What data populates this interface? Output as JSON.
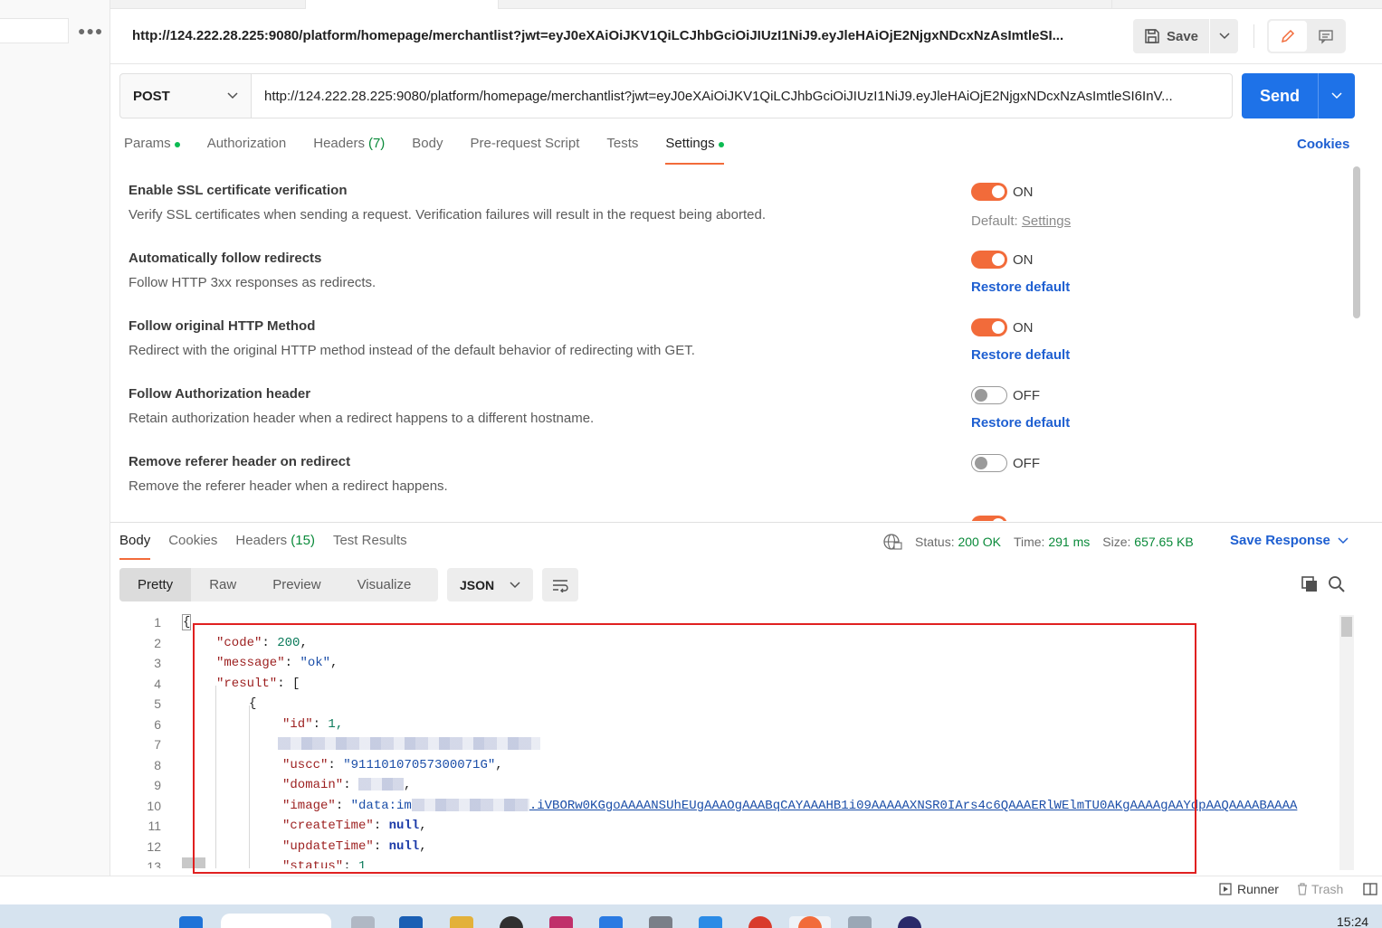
{
  "sidebar": {
    "more_icon": "more-icon"
  },
  "header": {
    "title": "http://124.222.28.225:9080/platform/homepage/merchantlist?jwt=eyJ0eXAiOiJKV1QiLCJhbGciOiJIUzI1NiJ9.eyJleHAiOjE2NjgxNDcxNzAsImtleSI...",
    "save_label": "Save"
  },
  "request": {
    "method": "POST",
    "url": "http://124.222.28.225:9080/platform/homepage/merchantlist?jwt=eyJ0eXAiOiJKV1QiLCJhbGciOiJIUzI1NiJ9.eyJleHAiOjE2NjgxNDcxNzAsImtleSI6InV...",
    "send_label": "Send"
  },
  "request_tabs": [
    {
      "label": "Params",
      "dot": true
    },
    {
      "label": "Authorization"
    },
    {
      "label": "Headers",
      "count": "(7)"
    },
    {
      "label": "Body"
    },
    {
      "label": "Pre-request Script"
    },
    {
      "label": "Tests"
    },
    {
      "label": "Settings",
      "dot": true,
      "active": true
    }
  ],
  "cookies_label": "Cookies",
  "settings": [
    {
      "title": "Enable SSL certificate verification",
      "desc": "Verify SSL certificates when sending a request. Verification failures will result in the request being aborted.",
      "state": "ON",
      "default_prefix": "Default:",
      "default_link": "Settings"
    },
    {
      "title": "Automatically follow redirects",
      "desc": "Follow HTTP 3xx responses as redirects.",
      "state": "ON",
      "restore": "Restore default"
    },
    {
      "title": "Follow original HTTP Method",
      "desc": "Redirect with the original HTTP method instead of the default behavior of redirecting with GET.",
      "state": "ON",
      "restore": "Restore default"
    },
    {
      "title": "Follow Authorization header",
      "desc": "Retain authorization header when a redirect happens to a different hostname.",
      "state": "OFF",
      "restore": "Restore default"
    },
    {
      "title": "Remove referer header on redirect",
      "desc": "Remove the referer header when a redirect happens.",
      "state": "OFF"
    }
  ],
  "response": {
    "tabs": [
      {
        "label": "Body",
        "active": true
      },
      {
        "label": "Cookies"
      },
      {
        "label": "Headers",
        "count": "(15)"
      },
      {
        "label": "Test Results"
      }
    ],
    "status_label": "Status:",
    "status_value": "200 OK",
    "time_label": "Time:",
    "time_value": "291 ms",
    "size_label": "Size:",
    "size_value": "657.65 KB",
    "save_response": "Save Response",
    "views": [
      "Pretty",
      "Raw",
      "Preview",
      "Visualize"
    ],
    "format": "JSON"
  },
  "code_lines": {
    "l1": "{",
    "l2_key": "\"code\"",
    "l2_val": "200",
    "l3_key": "\"message\"",
    "l3_val": "\"ok\"",
    "l4_key": "\"result\"",
    "l4_val": "[",
    "l5": "{",
    "l6_key": "\"id\"",
    "l6_val": "1,",
    "l8_key": "\"uscc\"",
    "l8_val": "\"91110107057300071G\"",
    "l9_key": "\"domain\"",
    "l10_key": "\"image\"",
    "l10_val_start": "\"data:im",
    "l10_val_end": ".iVBORw0KGgoAAAANSUhEUgAAAOgAAABqCAYAAAHB1i09AAAAAXNSR0IArs4c6QAAAERlWElmTU0AKgAAAAgAAYdpAAQAAAABAAAA",
    "l11_key": "\"createTime\"",
    "l11_val": "null",
    "l12_key": "\"updateTime\"",
    "l12_val": "null",
    "l13_key": "\"status\"",
    "l13_val": "1"
  },
  "footer": {
    "runner": "Runner",
    "trash": "Trash"
  },
  "taskbar": {
    "clock": "15:24"
  },
  "colors": {
    "accent": "#f26b3a",
    "primary": "#1e72e8",
    "link": "#1e5fd1",
    "success": "#0a8a3a"
  }
}
